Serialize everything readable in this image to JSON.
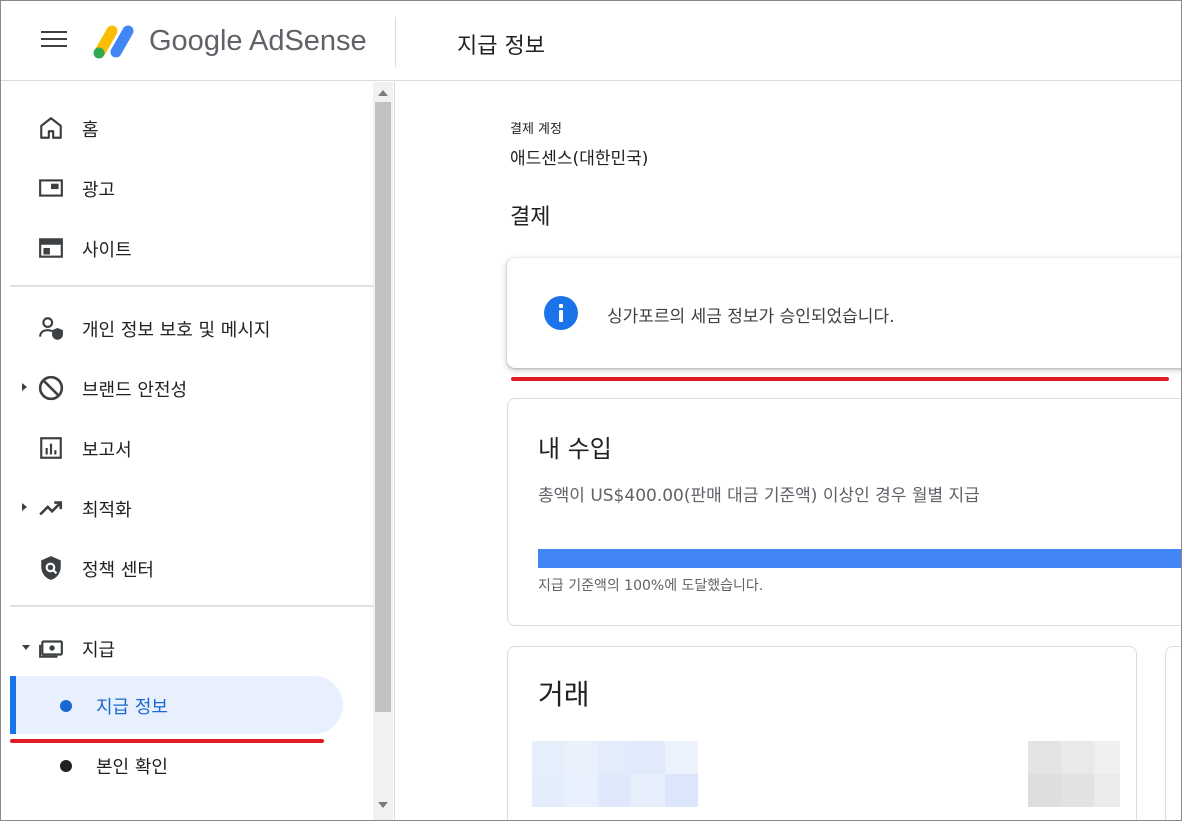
{
  "header": {
    "brand": "Google AdSense",
    "page_title": "지급 정보"
  },
  "sidebar": {
    "items": [
      {
        "label": "홈",
        "icon": "home-icon"
      },
      {
        "label": "광고",
        "icon": "ads-icon"
      },
      {
        "label": "사이트",
        "icon": "sites-icon"
      },
      {
        "label": "개인 정보 보호 및 메시지",
        "icon": "privacy-icon"
      },
      {
        "label": "브랜드 안전성",
        "icon": "block-icon"
      },
      {
        "label": "보고서",
        "icon": "report-icon"
      },
      {
        "label": "최적화",
        "icon": "trending-icon"
      },
      {
        "label": "정책 센터",
        "icon": "policy-icon"
      },
      {
        "label": "지급",
        "icon": "payments-icon"
      }
    ],
    "sub_items": [
      {
        "label": "지급 정보",
        "active": true
      },
      {
        "label": "본인 확인",
        "active": false
      }
    ]
  },
  "main": {
    "account_label": "결제 계정",
    "account_value": "애드센스(대한민국)",
    "section_title": "결제",
    "info_message": "싱가포르의 세금 정보가 승인되었습니다.",
    "earnings": {
      "title": "내 수입",
      "description": "총액이 US$400.00(판매 대금 기준액) 이상인 경우 월별 지급",
      "progress_percent": 100,
      "progress_note": "지급 기준액의 100%에 도달했습니다."
    },
    "transactions": {
      "title": "거래"
    }
  },
  "colors": {
    "accent": "#1a73e8",
    "progress": "#4285f4",
    "annotation_red": "#e01b24",
    "active_bg": "#e8f0fe"
  }
}
